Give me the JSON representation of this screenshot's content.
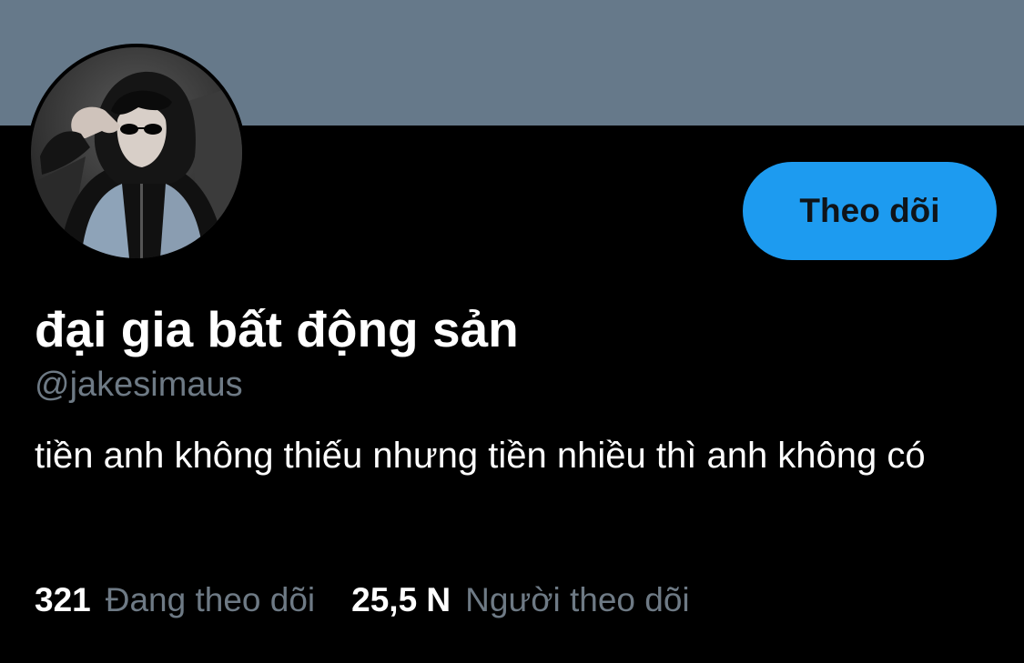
{
  "profile": {
    "display_name": "đại gia bất động sản",
    "handle": "@jakesimaus",
    "bio": "tiền anh không thiếu nhưng tiền nhiều thì anh không có",
    "follow_button_label": "Theo dõi"
  },
  "stats": {
    "following_count": "321",
    "following_label": "Đang theo dõi",
    "followers_count": "25,5 N",
    "followers_label": "Người theo dõi"
  },
  "colors": {
    "banner": "#66798a",
    "background": "#000000",
    "accent": "#1d9bf0",
    "muted_text": "#6e7a85"
  }
}
